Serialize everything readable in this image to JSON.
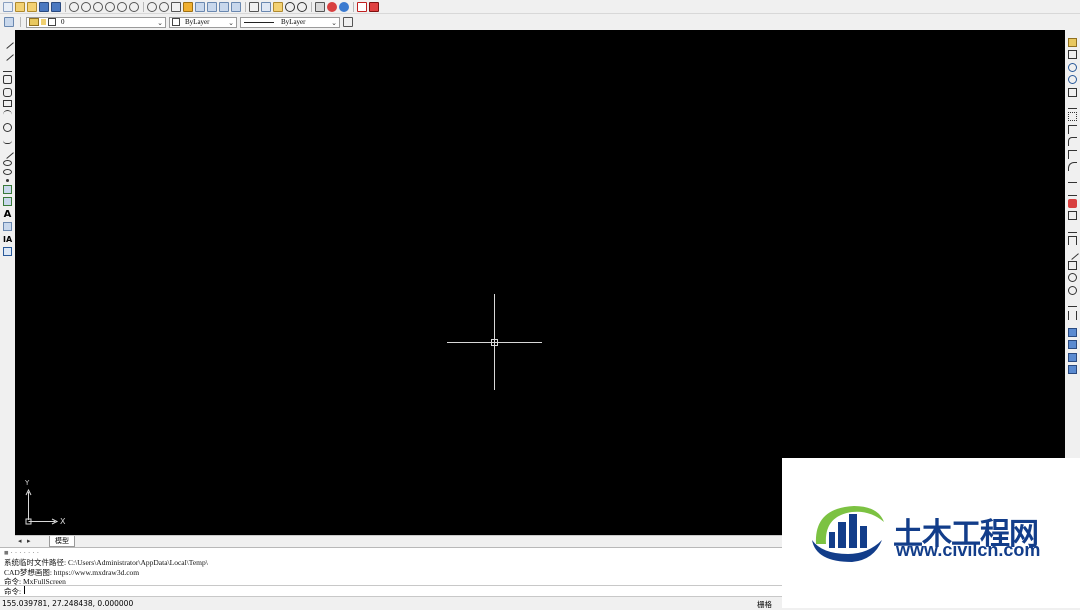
{
  "layer_toolbar": {
    "layer_name": "0",
    "color_value": "ByLayer",
    "linetype_value": "ByLayer"
  },
  "tabs": {
    "model_label": "模型"
  },
  "command_history": [
    "系统临时文件路径: C:\\Users\\Administrator\\AppData\\Local\\Temp\\",
    "CAD梦想画图: https://www.mxdraw3d.com",
    "命令:  MxFullScreen"
  ],
  "command_prompt": "命令:",
  "status_bar": {
    "coordinates": "155.039781,  27.248438,  0.000000",
    "grid_label": "栅格"
  },
  "ucs_icon": {
    "x_label": "X",
    "y_label": "Y"
  },
  "watermark": {
    "title": "土木工程网",
    "url": "www.civilcn.com"
  },
  "colors": {
    "canvas": "#000000",
    "ui_background": "#f0f0f0",
    "crosshair": "#d8d8d8",
    "logo_blue": "#123d8a",
    "logo_green": "#7cc242"
  }
}
